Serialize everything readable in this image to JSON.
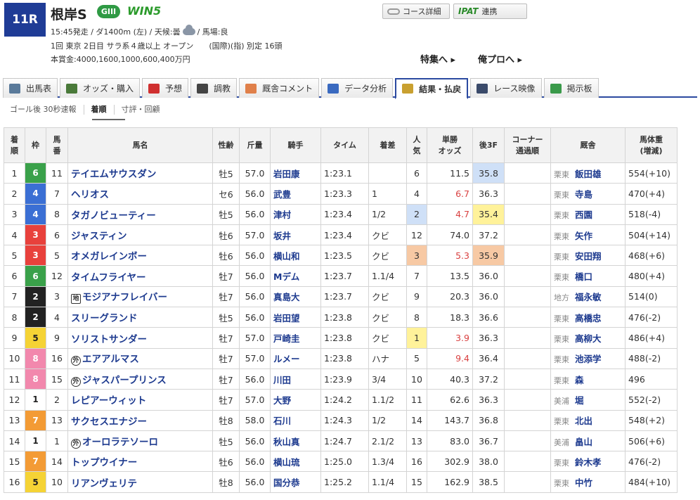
{
  "header": {
    "race_number": "11R",
    "race_name": "根岸S",
    "grade": "GIII",
    "win5_prefix": "WIN",
    "win5_num": "5",
    "info_line1_a": "15:45発走 / ダ1400m (左) / 天候:曇",
    "info_line1_b": "/ 馬場:良",
    "info_line2": "1回 東京 2日目 サラ系４歳以上 オープン　　(国際)(指) 別定 16頭",
    "info_line3": "本賞金:4000,1600,1000,600,400万円",
    "course_btn": "コース詳細",
    "ipat_logo": "IPAT",
    "ipat_btn": "連携",
    "link_special": "特集へ ▸",
    "link_orepro": "俺プロへ ▸"
  },
  "tabs": [
    {
      "label": "出馬表",
      "color": "#5a7a9a"
    },
    {
      "label": "オッズ・購入",
      "color": "#4a7a3a"
    },
    {
      "label": "予想",
      "color": "#d03030"
    },
    {
      "label": "調教",
      "color": "#444444"
    },
    {
      "label": "厩舎コメント",
      "color": "#e0804a"
    },
    {
      "label": "データ分析",
      "color": "#3a6ac0"
    },
    {
      "label": "結果・払戻",
      "color": "#c9a030"
    },
    {
      "label": "レース映像",
      "color": "#3a4a6a"
    },
    {
      "label": "掲示板",
      "color": "#3a9a4a"
    }
  ],
  "subnav": [
    "ゴール後 30秒速報",
    "着順",
    "寸評・回顧"
  ],
  "columns": {
    "rank": "着\n順",
    "waku": "枠",
    "umaban": "馬\n番",
    "name": "馬名",
    "sexage": "性齢",
    "weight": "斤量",
    "jockey": "騎手",
    "time": "タイム",
    "margin": "着差",
    "pop": "人\n気",
    "odds": "単勝\nオッズ",
    "last3f": "後3F",
    "corner": "コーナー\n通過順",
    "trainer": "厩舎",
    "bodyweight": "馬体重\n(増減)"
  },
  "colors": {
    "waku": {
      "1": "#ffffff",
      "2": "#222222",
      "3": "#e8413c",
      "4": "#3b6fd4",
      "5": "#f5d335",
      "6": "#3aa14a",
      "7": "#f39b35",
      "8": "#f288ad"
    },
    "last3f_1": "#fff29a",
    "last3f_2": "#cfe0f7",
    "last3f_3": "#f7c9a4"
  },
  "rows": [
    {
      "rank": "1",
      "waku": "6",
      "umaban": "11",
      "mark": "",
      "name": "テイエムサウスダン",
      "sexage": "牡5",
      "weight": "57.0",
      "jockey": "岩田康",
      "time": "1:23.1",
      "margin": "",
      "pop": "6",
      "odds": "11.5",
      "odds_red": false,
      "last3f": "35.8",
      "l3": 2,
      "corner": "",
      "loc": "栗東",
      "trainer": "飯田雄",
      "bw": "554(+10)"
    },
    {
      "rank": "2",
      "waku": "4",
      "umaban": "7",
      "mark": "",
      "name": "ヘリオス",
      "sexage": "セ6",
      "weight": "56.0",
      "jockey": "武豊",
      "time": "1:23.3",
      "margin": "1",
      "pop": "4",
      "odds": "6.7",
      "odds_red": true,
      "last3f": "36.3",
      "l3": 0,
      "corner": "",
      "loc": "栗東",
      "trainer": "寺島",
      "bw": "470(+4)"
    },
    {
      "rank": "3",
      "waku": "4",
      "umaban": "8",
      "mark": "",
      "name": "タガノビューティー",
      "sexage": "牡5",
      "weight": "56.0",
      "jockey": "津村",
      "time": "1:23.4",
      "margin": "1/2",
      "pop": "2",
      "odds": "4.7",
      "odds_red": true,
      "last3f": "35.4",
      "l3": 1,
      "corner": "",
      "loc": "栗東",
      "trainer": "西園",
      "bw": "518(-4)"
    },
    {
      "rank": "4",
      "waku": "3",
      "umaban": "6",
      "mark": "",
      "name": "ジャスティン",
      "sexage": "牡6",
      "weight": "57.0",
      "jockey": "坂井",
      "time": "1:23.4",
      "margin": "クビ",
      "pop": "12",
      "odds": "74.0",
      "odds_red": false,
      "last3f": "37.2",
      "l3": 0,
      "corner": "",
      "loc": "栗東",
      "trainer": "矢作",
      "bw": "504(+14)"
    },
    {
      "rank": "5",
      "waku": "3",
      "umaban": "5",
      "mark": "",
      "name": "オメガレインボー",
      "sexage": "牡6",
      "weight": "56.0",
      "jockey": "横山和",
      "time": "1:23.5",
      "margin": "クビ",
      "pop": "3",
      "odds": "5.3",
      "odds_red": true,
      "last3f": "35.9",
      "l3": 3,
      "corner": "",
      "loc": "栗東",
      "trainer": "安田翔",
      "bw": "468(+6)"
    },
    {
      "rank": "6",
      "waku": "6",
      "umaban": "12",
      "mark": "",
      "name": "タイムフライヤー",
      "sexage": "牡7",
      "weight": "56.0",
      "jockey": "Mデム",
      "time": "1:23.7",
      "margin": "1.1/4",
      "pop": "7",
      "odds": "13.5",
      "odds_red": false,
      "last3f": "36.0",
      "l3": 0,
      "corner": "",
      "loc": "栗東",
      "trainer": "橋口",
      "bw": "480(+4)"
    },
    {
      "rank": "7",
      "waku": "2",
      "umaban": "3",
      "mark": "地",
      "name": "モジアナフレイバー",
      "sexage": "牡7",
      "weight": "56.0",
      "jockey": "真島大",
      "time": "1:23.7",
      "margin": "クビ",
      "pop": "9",
      "odds": "20.3",
      "odds_red": false,
      "last3f": "36.0",
      "l3": 0,
      "corner": "",
      "loc": "地方",
      "trainer": "福永敏",
      "bw": "514(0)"
    },
    {
      "rank": "8",
      "waku": "2",
      "umaban": "4",
      "mark": "",
      "name": "スリーグランド",
      "sexage": "牡5",
      "weight": "56.0",
      "jockey": "岩田望",
      "time": "1:23.8",
      "margin": "クビ",
      "pop": "8",
      "odds": "18.3",
      "odds_red": false,
      "last3f": "36.6",
      "l3": 0,
      "corner": "",
      "loc": "栗東",
      "trainer": "高橋忠",
      "bw": "476(-2)"
    },
    {
      "rank": "9",
      "waku": "5",
      "umaban": "9",
      "mark": "",
      "name": "ソリストサンダー",
      "sexage": "牡7",
      "weight": "57.0",
      "jockey": "戸崎圭",
      "time": "1:23.8",
      "margin": "クビ",
      "pop": "1",
      "odds": "3.9",
      "odds_red": true,
      "last3f": "36.3",
      "l3": 0,
      "corner": "",
      "loc": "栗東",
      "trainer": "高柳大",
      "bw": "486(+4)"
    },
    {
      "rank": "10",
      "waku": "8",
      "umaban": "16",
      "mark": "外",
      "name": "エアアルマス",
      "sexage": "牡7",
      "weight": "57.0",
      "jockey": "ルメー",
      "time": "1:23.8",
      "margin": "ハナ",
      "pop": "5",
      "odds": "9.4",
      "odds_red": true,
      "last3f": "36.4",
      "l3": 0,
      "corner": "",
      "loc": "栗東",
      "trainer": "池添学",
      "bw": "488(-2)"
    },
    {
      "rank": "11",
      "waku": "8",
      "umaban": "15",
      "mark": "外",
      "name": "ジャスパープリンス",
      "sexage": "牡7",
      "weight": "56.0",
      "jockey": "川田",
      "time": "1:23.9",
      "margin": "3/4",
      "pop": "10",
      "odds": "40.3",
      "odds_red": false,
      "last3f": "37.2",
      "l3": 0,
      "corner": "",
      "loc": "栗東",
      "trainer": "森",
      "bw": "496"
    },
    {
      "rank": "12",
      "waku": "1",
      "umaban": "2",
      "mark": "",
      "name": "レピアーウィット",
      "sexage": "牡7",
      "weight": "57.0",
      "jockey": "大野",
      "time": "1:24.2",
      "margin": "1.1/2",
      "pop": "11",
      "odds": "62.6",
      "odds_red": false,
      "last3f": "36.3",
      "l3": 0,
      "corner": "",
      "loc": "美浦",
      "trainer": "堀",
      "bw": "552(-2)"
    },
    {
      "rank": "13",
      "waku": "7",
      "umaban": "13",
      "mark": "",
      "name": "サクセスエナジー",
      "sexage": "牡8",
      "weight": "58.0",
      "jockey": "石川",
      "time": "1:24.3",
      "margin": "1/2",
      "pop": "14",
      "odds": "143.7",
      "odds_red": false,
      "last3f": "36.8",
      "l3": 0,
      "corner": "",
      "loc": "栗東",
      "trainer": "北出",
      "bw": "548(+2)"
    },
    {
      "rank": "14",
      "waku": "1",
      "umaban": "1",
      "mark": "外",
      "name": "オーロラテソーロ",
      "sexage": "牡5",
      "weight": "56.0",
      "jockey": "秋山真",
      "time": "1:24.7",
      "margin": "2.1/2",
      "pop": "13",
      "odds": "83.0",
      "odds_red": false,
      "last3f": "36.7",
      "l3": 0,
      "corner": "",
      "loc": "美浦",
      "trainer": "畠山",
      "bw": "506(+6)"
    },
    {
      "rank": "15",
      "waku": "7",
      "umaban": "14",
      "mark": "",
      "name": "トップウイナー",
      "sexage": "牡6",
      "weight": "56.0",
      "jockey": "横山琉",
      "time": "1:25.0",
      "margin": "1.3/4",
      "pop": "16",
      "odds": "302.9",
      "odds_red": false,
      "last3f": "38.0",
      "l3": 0,
      "corner": "",
      "loc": "栗東",
      "trainer": "鈴木孝",
      "bw": "476(-2)"
    },
    {
      "rank": "16",
      "waku": "5",
      "umaban": "10",
      "mark": "",
      "name": "リアンヴェリテ",
      "sexage": "牡8",
      "weight": "56.0",
      "jockey": "国分恭",
      "time": "1:25.2",
      "margin": "1.1/4",
      "pop": "15",
      "odds": "162.9",
      "odds_red": false,
      "last3f": "38.5",
      "l3": 0,
      "corner": "",
      "loc": "栗東",
      "trainer": "中竹",
      "bw": "484(+10)"
    }
  ]
}
